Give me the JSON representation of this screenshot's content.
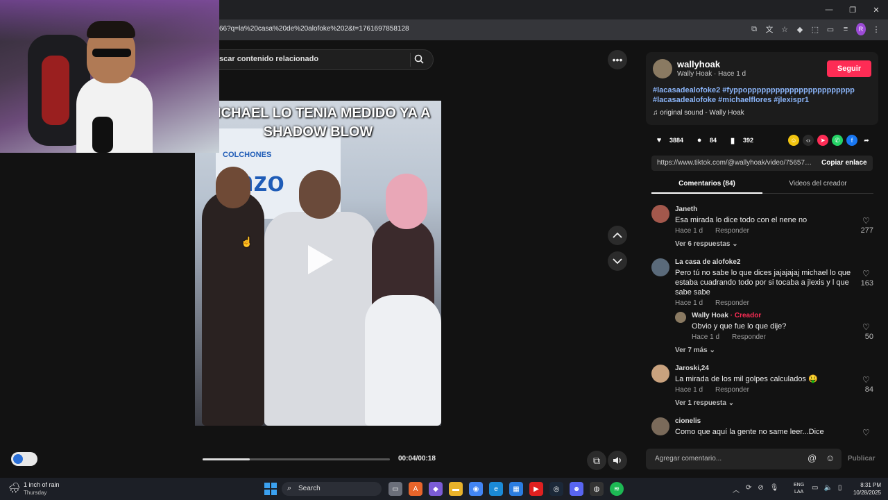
{
  "browser": {
    "url": "66?q=la%20casa%20de%20alofoke%202&t=1761697858128",
    "window_controls": [
      "—",
      "❐",
      "✕"
    ],
    "toolbar_icons": [
      "⧉",
      "文",
      "☆",
      "◆",
      "⬚",
      "▭",
      "≡"
    ],
    "profile_initial": "R",
    "menu": "⋮"
  },
  "search": {
    "placeholder": "scar contenido relacionado",
    "icon": "search-icon"
  },
  "video": {
    "caption": "MICHAEL LO TENIA MEDIDO YA A SHADOW BLOW",
    "banner_small": "COLCHONES",
    "banner_big": "nzo",
    "time": "00:04/00:18",
    "progress": 0.25
  },
  "buttons": {
    "more": "•••",
    "up": "︿",
    "down": "﹀",
    "pip": "⧉",
    "mute": "🔊"
  },
  "post": {
    "username": "wallyhoak",
    "subline": "Wally Hoak · Hace 1 d",
    "follow": "Seguir",
    "hashtags_line1": "#lacasadealofoke2 #fyppoppppppppppppppppppppppp",
    "hashtags_line2": "#lacasadealofoke #michaelflores #jlexispr1",
    "sound": "♫  original sound - Wally Hoak",
    "likes": "3884",
    "comments": "84",
    "saves": "392",
    "link": "https://www.tiktok.com/@wallyhoak/video/756574...",
    "copy": "Copiar enlace"
  },
  "tabs": {
    "comments": "Comentarios (84)",
    "videos": "Videos del creador"
  },
  "comments": [
    {
      "user": "Janeth",
      "text": "Esa mirada lo dice todo con el nene no",
      "time": "Hace 1 d",
      "reply": "Responder",
      "likes": "277",
      "more": "Ver 6 respuestas ⌄"
    },
    {
      "user": "La casa de alofoke2",
      "text": "Pero tú no sabe lo que dices jajajajaj michael lo que estaba cuadrando todo por si tocaba a jlexis y l que sabe sabe",
      "time": "Hace 1 d",
      "reply": "Responder",
      "likes": "163"
    },
    {
      "user": "Wally Hoak",
      "creator": " · Creador",
      "text": "Obvio y que fue lo que dije?",
      "time": "Hace 1 d",
      "reply": "Responder",
      "likes": "50",
      "more": "Ver 7 más ⌄"
    },
    {
      "user": "Jaroski,24",
      "text": "La mirada de los mil golpes calculados 🤑",
      "time": "Hace 1 d",
      "reply": "Responder",
      "likes": "84",
      "more": "Ver 1 respuesta ⌄"
    },
    {
      "user": "cionelis",
      "text": "Como que aquí la gente no same leer...Dice MEDIDO",
      "likes": ""
    }
  ],
  "comment_input": {
    "placeholder": "Agregar comentario...",
    "at": "@",
    "emoji": "☺",
    "publish": "Publicar"
  },
  "taskbar": {
    "weather_temp": "1 inch of rain",
    "weather_day": "Thursday",
    "search": "Search",
    "lang1": "ENG",
    "lang2": "LAA",
    "time": "8:31 PM",
    "date": "10/28/2025"
  }
}
